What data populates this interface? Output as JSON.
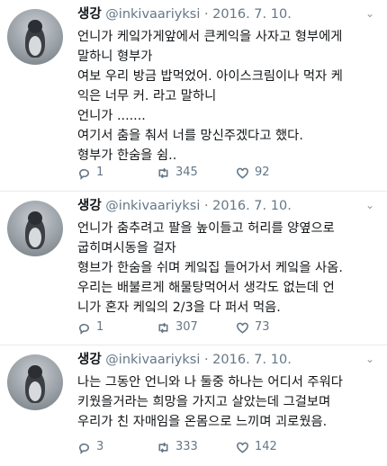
{
  "tweets": [
    {
      "name": "생강",
      "handle": "@inkivaariyksi",
      "date": "· 2016. 7. 10.",
      "lines": [
        "언니가 케잌가게앞에서 큰케익을 사자고 형부에게",
        "말하니 형부가",
        "여보 우리 방금 밥먹었어. 아이스크림이나 먹자 케",
        "익은 너무 커. 라고 말하니",
        "언니가 .......",
        "여기서 춤을 춰서 너를 망신주겠다고 했다.",
        "형부가 한숨을 쉼.."
      ],
      "replies": "1",
      "retweets": "345",
      "likes": "92"
    },
    {
      "name": "생강",
      "handle": "@inkivaariyksi",
      "date": "· 2016. 7. 10.",
      "lines": [
        "언니가 춤추려고  팔을 높이들고 허리를 양옆으로",
        "굽히며시동을 걸자",
        "형브가 한숨을 쉬며 케잌집 들어가서 케잌을 사옴.",
        "우리는 배불르게 해물탕먹어서 생각도 없는데 언",
        "니가 혼자 케잌의 2/3을 다 퍼서 먹음."
      ],
      "replies": "1",
      "retweets": "307",
      "likes": "73"
    },
    {
      "name": "생강",
      "handle": "@inkivaariyksi",
      "date": "· 2016. 7. 10.",
      "lines": [
        "나는 그동안 언니와 나 둘중 하나는 어디서 주워다",
        "키웠을거라는 희망을 가지고 살았는데  그걸보며",
        "우리가 친 자매임을 온몸으로 느끼며 괴로웠음."
      ],
      "replies": "3",
      "retweets": "333",
      "likes": "142"
    }
  ],
  "icons": {
    "reply": "reply-icon",
    "retweet": "retweet-icon",
    "like": "heart-icon",
    "more": "chevron-down-icon"
  },
  "colors": {
    "text": "#14171a",
    "meta": "#657786",
    "divider": "#e6ecf0"
  }
}
